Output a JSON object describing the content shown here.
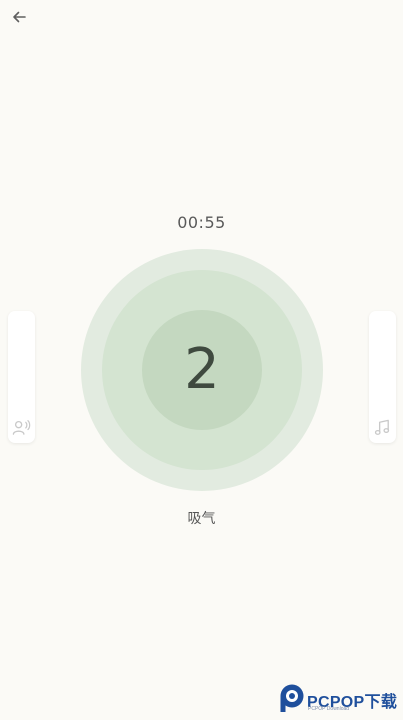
{
  "header": {
    "back_icon": "arrow-left-icon"
  },
  "session": {
    "timer": "00:55",
    "count": "2",
    "phase": "吸气"
  },
  "side_controls": {
    "left_icon": "voice-guide-icon",
    "right_icon": "music-note-icon"
  },
  "colors": {
    "background": "#fbfaf6",
    "circle_outer": "#e2ebe0",
    "circle_middle": "#d4e4d1",
    "circle_inner": "#c4d8c0",
    "count_text": "#3f4a3f",
    "logo_blue": "#1f4f9c"
  },
  "watermark": {
    "name": "PCPOP下载",
    "tagline": "PCPOP Download"
  }
}
